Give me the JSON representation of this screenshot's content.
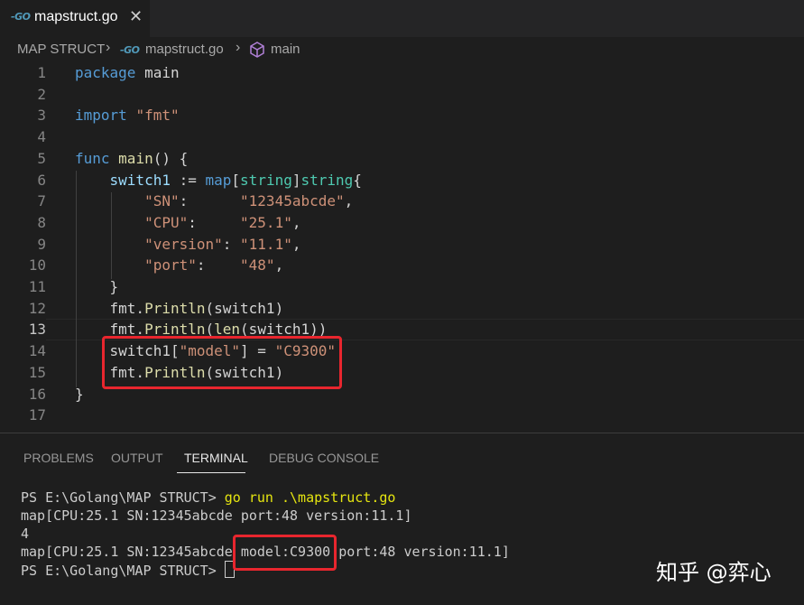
{
  "tab": {
    "icon": "go-file-icon",
    "icon_text": "-GO",
    "label": "mapstruct.go",
    "close": "✕"
  },
  "breadcrumb": {
    "folder": "MAP STRUCT",
    "file_icon_text": "-GO",
    "file": "mapstruct.go",
    "symbol": "main"
  },
  "code": [
    {
      "n": "1",
      "tokens": [
        [
          "kw",
          "package"
        ],
        [
          "plain",
          " main"
        ]
      ]
    },
    {
      "n": "2",
      "tokens": []
    },
    {
      "n": "3",
      "tokens": [
        [
          "kw",
          "import"
        ],
        [
          "plain",
          " "
        ],
        [
          "str",
          "\"fmt\""
        ]
      ]
    },
    {
      "n": "4",
      "tokens": []
    },
    {
      "n": "5",
      "tokens": [
        [
          "kw",
          "func"
        ],
        [
          "plain",
          " "
        ],
        [
          "fn",
          "main"
        ],
        [
          "plain",
          "() {"
        ]
      ]
    },
    {
      "n": "6",
      "tokens": [
        [
          "plain",
          "    "
        ],
        [
          "var",
          "switch1"
        ],
        [
          "plain",
          " := "
        ],
        [
          "kw",
          "map"
        ],
        [
          "plain",
          "["
        ],
        [
          "type",
          "string"
        ],
        [
          "plain",
          "]"
        ],
        [
          "type",
          "string"
        ],
        [
          "plain",
          "{"
        ]
      ]
    },
    {
      "n": "7",
      "tokens": [
        [
          "plain",
          "        "
        ],
        [
          "str",
          "\"SN\""
        ],
        [
          "plain",
          ":      "
        ],
        [
          "str",
          "\"12345abcde\""
        ],
        [
          "plain",
          ","
        ]
      ]
    },
    {
      "n": "8",
      "tokens": [
        [
          "plain",
          "        "
        ],
        [
          "str",
          "\"CPU\""
        ],
        [
          "plain",
          ":     "
        ],
        [
          "str",
          "\"25.1\""
        ],
        [
          "plain",
          ","
        ]
      ]
    },
    {
      "n": "9",
      "tokens": [
        [
          "plain",
          "        "
        ],
        [
          "str",
          "\"version\""
        ],
        [
          "plain",
          ": "
        ],
        [
          "str",
          "\"11.1\""
        ],
        [
          "plain",
          ","
        ]
      ]
    },
    {
      "n": "10",
      "tokens": [
        [
          "plain",
          "        "
        ],
        [
          "str",
          "\"port\""
        ],
        [
          "plain",
          ":    "
        ],
        [
          "str",
          "\"48\""
        ],
        [
          "plain",
          ","
        ]
      ]
    },
    {
      "n": "11",
      "tokens": [
        [
          "plain",
          "    }"
        ]
      ]
    },
    {
      "n": "12",
      "tokens": [
        [
          "plain",
          "    fmt."
        ],
        [
          "fn",
          "Println"
        ],
        [
          "plain",
          "(switch1)"
        ]
      ]
    },
    {
      "n": "13",
      "tokens": [
        [
          "plain",
          "    fmt."
        ],
        [
          "fn",
          "Println"
        ],
        [
          "plain",
          "("
        ],
        [
          "fn",
          "len"
        ],
        [
          "plain",
          "(switch1))"
        ]
      ]
    },
    {
      "n": "14",
      "tokens": [
        [
          "plain",
          "    switch1["
        ],
        [
          "str",
          "\"model\""
        ],
        [
          "plain",
          "] = "
        ],
        [
          "str",
          "\"C9300\""
        ]
      ]
    },
    {
      "n": "15",
      "tokens": [
        [
          "plain",
          "    fmt."
        ],
        [
          "fn",
          "Println"
        ],
        [
          "plain",
          "(switch1)"
        ]
      ]
    },
    {
      "n": "16",
      "tokens": [
        [
          "plain",
          "}"
        ]
      ]
    },
    {
      "n": "17",
      "tokens": []
    }
  ],
  "panel_tabs": [
    "PROBLEMS",
    "OUTPUT",
    "TERMINAL",
    "DEBUG CONSOLE"
  ],
  "terminal": {
    "prompt": "PS E:\\Golang\\MAP STRUCT> ",
    "command": "go run .\\mapstruct.go",
    "output1": "map[CPU:25.1 SN:12345abcde port:48 version:11.1]",
    "output2": "4",
    "output3_a": "map[CPU:25.1 SN:12345abcde ",
    "output3_b": "model:C9300",
    "output3_c": " port:48 version:11.1]",
    "prompt2": "PS E:\\Golang\\MAP STRUCT> "
  },
  "watermark": "知乎 @弈心"
}
